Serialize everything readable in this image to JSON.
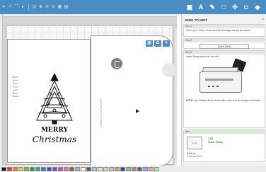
{
  "toolbar": {
    "left_icons": [
      "pointer-icon",
      "node-edit-icon",
      "curve-icon",
      "arrow-icon",
      "zoom-fit-icon",
      "zoom-in-icon",
      "zoom-out-icon",
      "zoom-page-icon",
      "grid-icon",
      "align-icon"
    ],
    "right_icons": [
      "design-icon",
      "text-icon",
      "draw-icon",
      "shapes-icon",
      "trace-icon",
      "mint-icon",
      "send-icon"
    ],
    "right_labels": [
      "▣",
      "A",
      "✎",
      "□",
      "✣",
      "◘",
      "◆"
    ]
  },
  "canvas": {
    "mint_label": "mint",
    "design_line1": "MERRY",
    "design_line2": "Christmas",
    "side_text": "CREATED WITH MINT"
  },
  "panel": {
    "title": "SEND TO MINT",
    "close_glyph": "×",
    "step1": {
      "head": "Step 1",
      "text_before": "Check your ",
      "link": "Stamp",
      "text_after": " to ensure that all images are set as desired."
    },
    "step2": {
      "head": "Step 2",
      "button_label": "Select Blank"
    },
    "step3": {
      "head": "Step 3",
      "text": "Insert Stamp sheet into the slot."
    },
    "note": {
      "prefix": "NOTE:",
      "text": " Your Stamp will be stored within mint until the design is removed."
    },
    "stamp": {
      "head": "Mint",
      "thumb_label": "2424",
      "name_label": "2424",
      "status_label": "Status:",
      "status_value": "Ready",
      "foot_label": "Refill link",
      "foot_link": "Purchase Refill"
    }
  },
  "swatch_colors": [
    "#1a1a1a",
    "#e03a2f",
    "#f07a2a",
    "#f4c93b",
    "#7cc04a",
    "#2e9a4a",
    "#27a8a0",
    "#2a7bd3",
    "#3b4fb8",
    "#7a4bb8",
    "#c24bb1",
    "#e86a9a",
    "#8a5a3a",
    "#b0b0b0",
    "#ffffff",
    "#5a5a5a",
    "#9ad3f0",
    "#f5e3a0",
    "#c5e6b8",
    "#f2b8c8",
    "#d0a070",
    "#404080",
    "#80c0c0",
    "#c08080",
    "#606060",
    "#a0a0ff",
    "#ffa0a0",
    "#a0ffa0"
  ]
}
